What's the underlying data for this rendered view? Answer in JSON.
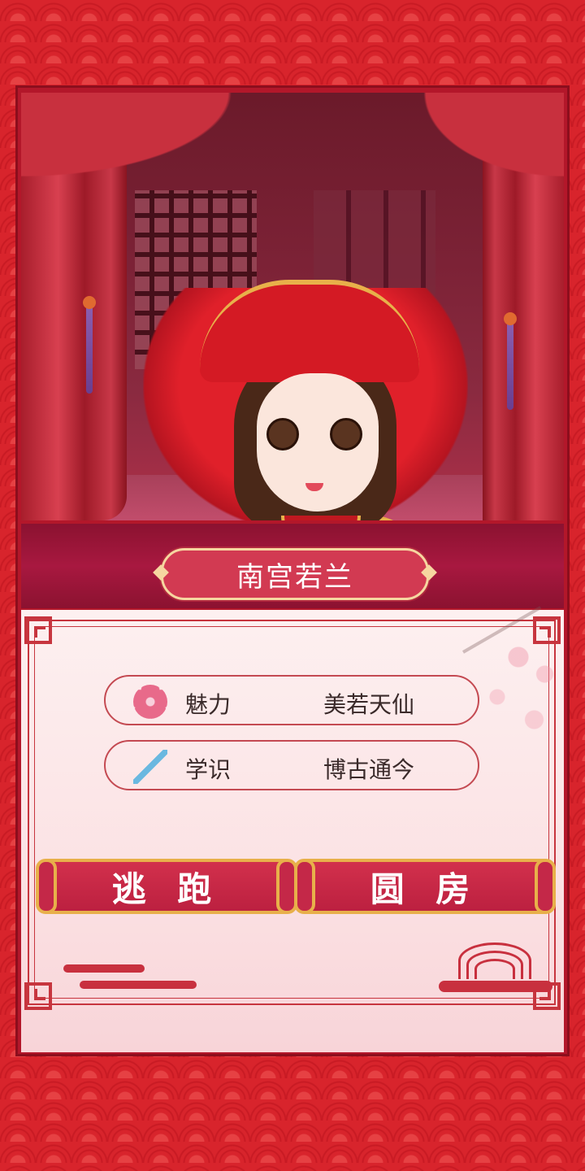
{
  "character": {
    "name": "南宫若兰"
  },
  "stats": [
    {
      "icon": "plum-blossom-icon",
      "label": "魅力",
      "value": "美若天仙"
    },
    {
      "icon": "writing-brush-icon",
      "label": "学识",
      "value": "博古通今"
    }
  ],
  "actions": {
    "escape_label": "逃 跑",
    "consummate_label": "圆 房"
  },
  "colors": {
    "background": "#d8242c",
    "banner": "#a81840",
    "button": "#c42848",
    "gold": "#e8b04a"
  }
}
